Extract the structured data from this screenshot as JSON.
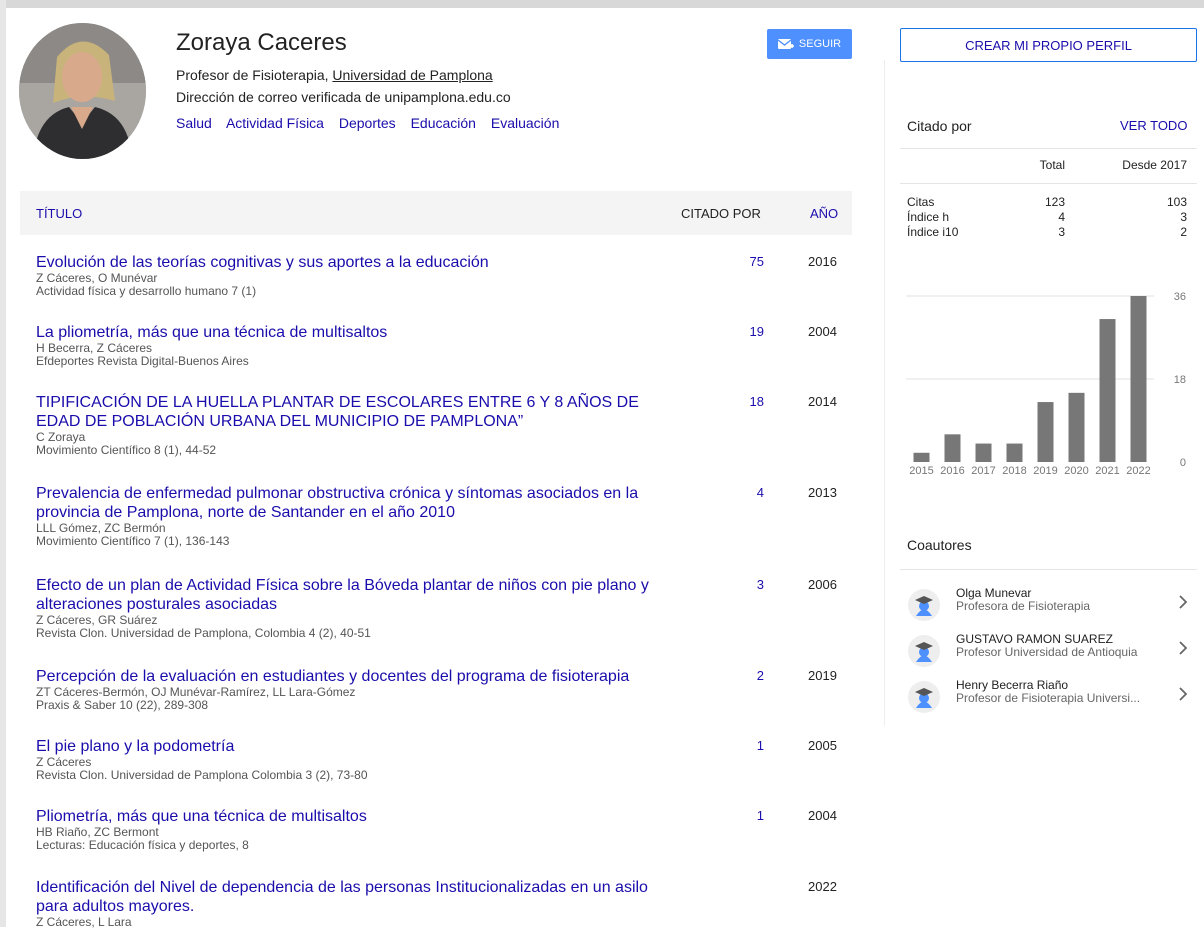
{
  "profile": {
    "name": "Zoraya Caceres",
    "affiliation_prefix": "Profesor de Fisioterapia, ",
    "affiliation_link": "Universidad de Pamplona",
    "email_verified": "Dirección de correo verificada de unipamplona.edu.co",
    "interests": [
      "Salud",
      "Actividad Física",
      "Deportes",
      "Educación",
      "Evaluación"
    ],
    "follow_label": "SEGUIR",
    "follow_icon": "email-follow-icon"
  },
  "table": {
    "col_title": "TÍTULO",
    "col_cited": "CITADO POR",
    "col_year": "AÑO",
    "articles": [
      {
        "title": "Evolución de las teorías cognitivas y sus aportes a la educación",
        "authors": "Z Cáceres, O Munévar",
        "venue": "Actividad física y desarrollo humano 7 (1)",
        "cited": "75",
        "year": "2016"
      },
      {
        "title": "La pliometría, más que una técnica de multisaltos",
        "authors": "H Becerra, Z Cáceres",
        "venue": "Efdeportes Revista Digital-Buenos Aires",
        "cited": "19",
        "year": "2004"
      },
      {
        "title": "TIPIFICACIÓN DE LA HUELLA PLANTAR DE ESCOLARES ENTRE 6 Y 8 AÑOS DE EDAD DE POBLACIÓN URBANA DEL MUNICIPIO DE PAMPLONA”",
        "authors": "C Zoraya",
        "venue": "Movimiento Científico 8 (1), 44-52",
        "cited": "18",
        "year": "2014"
      },
      {
        "title": "Prevalencia de enfermedad pulmonar obstructiva crónica y síntomas asociados en la provincia de Pamplona, norte de Santander en el año 2010",
        "authors": "LLL Gómez, ZC Bermón",
        "venue": "Movimiento Científico 7 (1), 136-143",
        "cited": "4",
        "year": "2013"
      },
      {
        "title": "Efecto de un plan de Actividad Física sobre la Bóveda plantar de niños con pie plano y alteraciones posturales asociadas",
        "authors": "Z Cáceres, GR Suárez",
        "venue": "Revista Clon. Universidad de Pamplona, Colombia 4 (2), 40-51",
        "cited": "3",
        "year": "2006"
      },
      {
        "title": "Percepción de la evaluación en estudiantes y docentes del programa de fisioterapia",
        "authors": "ZT Cáceres-Bermón, OJ Munévar-Ramírez, LL Lara-Gómez",
        "venue": "Praxis & Saber 10 (22), 289-308",
        "cited": "2",
        "year": "2019"
      },
      {
        "title": "El pie plano y la podometría",
        "authors": "Z Cáceres",
        "venue": "Revista Clon. Universidad de Pamplona Colombia 3 (2), 73-80",
        "cited": "1",
        "year": "2005"
      },
      {
        "title": "Pliometría, más que una técnica de multisaltos",
        "authors": "HB Riaño, ZC Bermont",
        "venue": "Lecturas: Educación física y deportes, 8",
        "cited": "1",
        "year": "2004"
      },
      {
        "title": "Identificación del Nivel de dependencia de las personas Institucionalizadas en un asilo para adultos mayores.",
        "authors": "Z Cáceres, L Lara",
        "venue": "",
        "cited": "",
        "year": "2022"
      }
    ]
  },
  "sidebar": {
    "create_profile_label": "CREAR MI PROPIO PERFIL",
    "cited_by_title": "Citado por",
    "view_all_label": "VER TODO",
    "stats": {
      "col_total": "Total",
      "col_since": "Desde 2017",
      "rows": [
        {
          "label": "Citas",
          "total": "123",
          "since": "103"
        },
        {
          "label": "Índice h",
          "total": "4",
          "since": "3"
        },
        {
          "label": "Índice i10",
          "total": "3",
          "since": "2"
        }
      ]
    },
    "coauthors_title": "Coautores",
    "coauthors": [
      {
        "name": "Olga Munevar",
        "affiliation": "Profesora de Fisioterapia",
        "icon": "scholar-avatar-icon"
      },
      {
        "name": "GUSTAVO RAMON SUAREZ",
        "affiliation": "Profesor Universidad de Antioquia",
        "icon": "scholar-avatar-icon"
      },
      {
        "name": "Henry Becerra Riaño",
        "affiliation": "Profesor de Fisioterapia Universi...",
        "icon": "scholar-avatar-icon"
      }
    ]
  },
  "chart_data": {
    "type": "bar",
    "categories": [
      "2015",
      "2016",
      "2017",
      "2018",
      "2019",
      "2020",
      "2021",
      "2022"
    ],
    "values": [
      2,
      6,
      4,
      4,
      13,
      15,
      31,
      36
    ],
    "yticks": [
      "0",
      "18",
      "36"
    ],
    "ylim": [
      0,
      36
    ],
    "grid": true,
    "color": "#777777"
  },
  "colors": {
    "link": "#1a0dab",
    "button": "#4d90fe",
    "header_bg": "#f4f4f4"
  }
}
